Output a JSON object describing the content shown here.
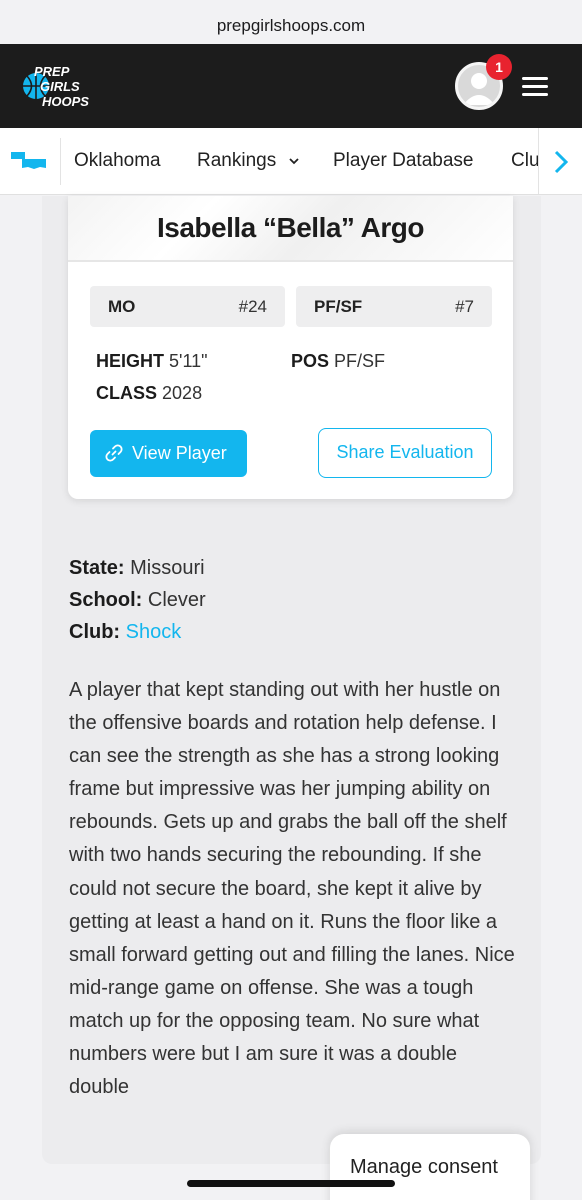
{
  "browser": {
    "url": "prepgirlshoops.com"
  },
  "header": {
    "logo_lines": [
      "PREP",
      "GIRLS",
      "HOOPS"
    ],
    "notification_count": "1"
  },
  "nav": {
    "items": [
      {
        "label": "Oklahoma"
      },
      {
        "label": "Rankings"
      },
      {
        "label": "Player Database"
      },
      {
        "label": "Clu"
      }
    ]
  },
  "player": {
    "name": "Isabella “Bella” Argo",
    "state_abbr": "MO",
    "state_rank": "#24",
    "position_pill": "PF/SF",
    "position_rank": "#7",
    "height_label": "HEIGHT",
    "height_value": "5'11\"",
    "pos_label": "POS",
    "pos_value": "PF/SF",
    "class_label": "CLASS",
    "class_value": "2028",
    "view_button": "View Player",
    "share_button": "Share Evaluation"
  },
  "details": {
    "state_label": "State:",
    "state_value": "Missouri",
    "school_label": "School:",
    "school_value": "Clever",
    "club_label": "Club:",
    "club_value": "Shock"
  },
  "evaluation": "A player that kept standing out with her hustle on the offensive boards and rotation help defense. I can see the strength as she has a strong looking frame but impressive was her jumping ability on rebounds. Gets up and grabs the ball off the shelf with two hands securing the rebounding. If she could not secure the board, she kept it alive by getting at least a hand on it. Runs the floor like a small forward getting out and filling the lanes. Nice mid-range game on offense. She was a tough match up for the opposing team. No sure what numbers were but I am sure it was a double double",
  "consent": {
    "label": "Manage consent"
  },
  "colors": {
    "accent": "#13b6ee",
    "header_bg": "#1c1c1c",
    "badge": "#e8232f"
  },
  "icons": [
    "oklahoma-state-icon",
    "chevron-down-icon",
    "chevron-right-icon",
    "link-icon",
    "user-avatar-icon",
    "hamburger-menu-icon"
  ]
}
